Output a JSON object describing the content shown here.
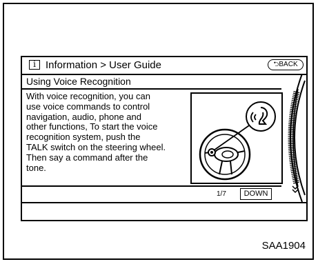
{
  "header": {
    "title": "Information > User Guide",
    "back_label": "BACK"
  },
  "section": {
    "title": "Using Voice Recognition"
  },
  "content": {
    "lines": [
      "With voice recognition, you can",
      "use voice commands to control",
      "navigation, audio, phone and",
      "other functions, To start the voice",
      "recognition system, push the",
      "TALK switch on the steering wheel.",
      "Then say a command after the",
      "tone."
    ]
  },
  "footer": {
    "page": "1/7",
    "down_label": "DOWN"
  },
  "figure_code": "SAA1904",
  "icons": [
    "info-icon",
    "back-arrow-icon",
    "steering-wheel-icon",
    "voice-talk-icon",
    "scroll-down-icon"
  ]
}
